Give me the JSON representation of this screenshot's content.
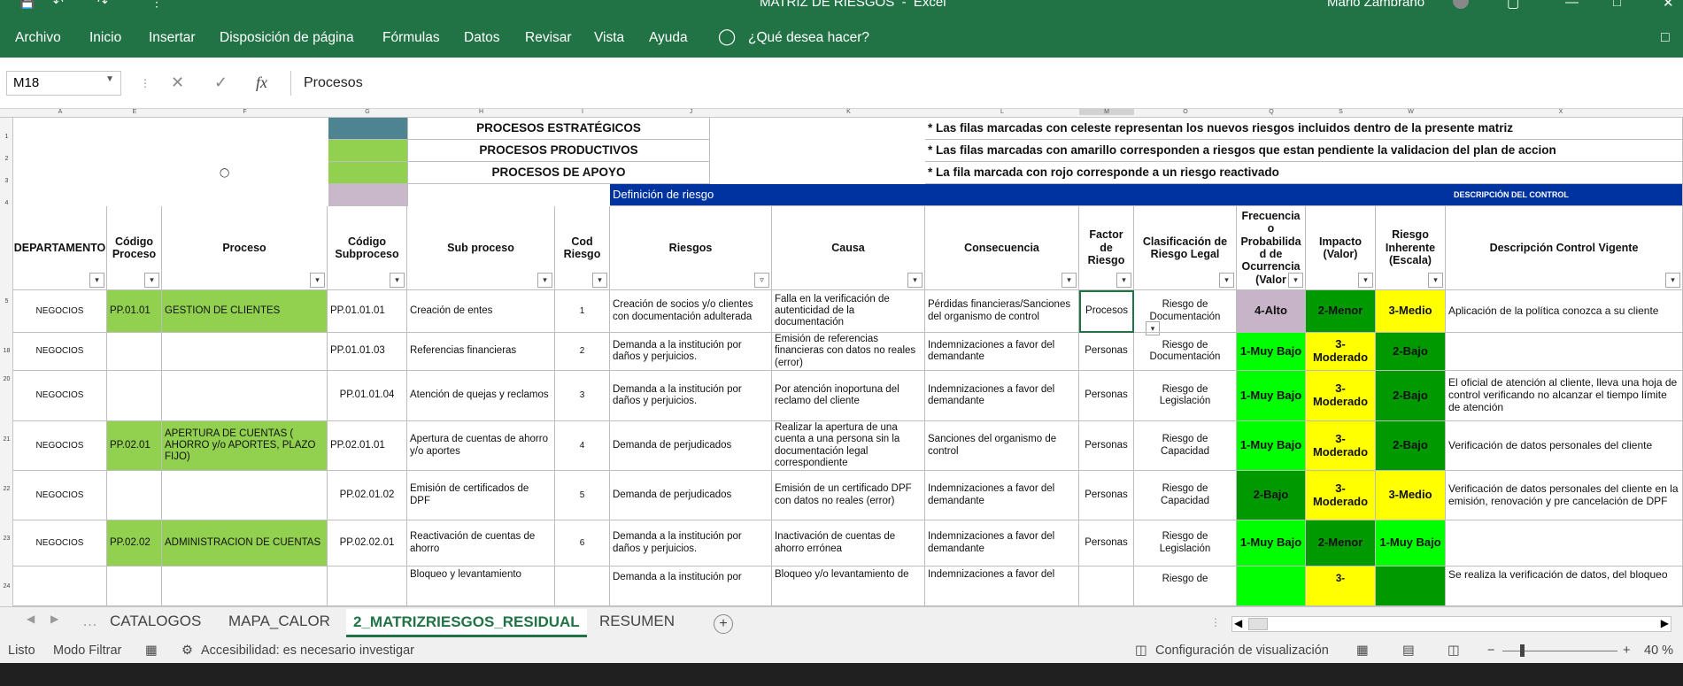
{
  "window": {
    "title": "MATRIZ DE RIESGOS  -  Excel",
    "user": "Mario Zambrano"
  },
  "ribbon": {
    "tabs": [
      "Archivo",
      "Inicio",
      "Insertar",
      "Disposición de página",
      "Fórmulas",
      "Datos",
      "Revisar",
      "Vista",
      "Ayuda",
      "¿Qué desea hacer?"
    ]
  },
  "formula_bar": {
    "name_box": "M18",
    "content": "Procesos"
  },
  "column_headers": [
    "A",
    "E",
    "F",
    "G",
    "H",
    "I",
    "J",
    "K",
    "L",
    "M",
    "O",
    "Q",
    "S",
    "W",
    "X"
  ],
  "row_numbers": [
    "1",
    "2",
    "3",
    "4",
    "5",
    "18",
    "20",
    "21",
    "22",
    "23",
    "24"
  ],
  "legend": {
    "strategic": "PROCESOS ESTRATÉGICOS",
    "productive": "PROCESOS PRODUCTIVOS",
    "support": "PROCESOS DE APOYO",
    "note_1": "* Las filas marcadas con celeste representan los nuevos riesgos incluidos dentro de la presente matriz",
    "note_2": "* Las filas marcadas con amarillo corresponden a riesgos que estan pendiente la validacion del plan de accion",
    "note_3": "* La fila marcada con rojo corresponde a un riesgo reactivado",
    "section_risk": "Definición de riesgo",
    "section_control": "DESCRIPCIÓN DEL CONTROL"
  },
  "table": {
    "headers": [
      "DEPARTAMENTO",
      "Código Proceso",
      "Proceso",
      "Código Subproceso",
      "Sub proceso",
      "Cod Riesgo",
      "Riesgos",
      "Causa",
      "Consecuencia",
      "Factor de Riesgo",
      "Clasificación de Riesgo Legal",
      "Frecuencia o Probabilida d de Ocurrencia (Valor",
      "Impacto (Valor)",
      "Riesgo Inherente (Escala)",
      "Descripción Control Vigente"
    ],
    "rows": [
      [
        "NEGOCIOS",
        "PP.01.01",
        "GESTION DE CLIENTES",
        "PP.01.01.01",
        "Creación de entes",
        "1",
        "Creación de socios y/o clientes con documentación adulterada",
        "Falla en la verificación de autenticidad de la documentación",
        "Pérdidas financieras/Sanciones del organismo de control",
        "Procesos",
        "Riesgo de Documentación",
        "4-Alto",
        "2-Menor",
        "3-Medio",
        "Aplicación de la política conozca a su cliente"
      ],
      [
        "NEGOCIOS",
        "",
        "",
        "PP.01.01.03",
        "Referencias financieras",
        "2",
        "Demanda a la institución por daños y perjuicios.",
        "Emisión de referencias financieras con datos no reales (error)",
        "Indemnizaciones a favor del demandante",
        "Personas",
        "Riesgo de Documentación",
        "1-Muy Bajo",
        "3-Moderado",
        "2-Bajo",
        ""
      ],
      [
        "NEGOCIOS",
        "",
        "",
        "PP.01.01.04",
        "Atención de quejas y reclamos",
        "3",
        "Demanda a la institución por daños y perjuicios.",
        "Por atención inoportuna del reclamo del cliente",
        "Indemnizaciones a favor del demandante",
        "Personas",
        "Riesgo de Legislación",
        "1-Muy Bajo",
        "3-Moderado",
        "2-Bajo",
        "El oficial de atención al cliente, lleva una hoja de control verificando no alcanzar el tiempo límite de atención"
      ],
      [
        "NEGOCIOS",
        "PP.02.01",
        "APERTURA DE CUENTAS ( AHORRO y/o APORTES, PLAZO FIJO)",
        "PP.02.01.01",
        "Apertura  de cuentas de ahorro y/o aportes",
        "4",
        "Demanda de perjudicados",
        "Realizar la apertura de una cuenta a una persona sin la documentación legal correspondiente",
        "Sanciones del organismo de control",
        "Personas",
        "Riesgo de Capacidad",
        "1-Muy Bajo",
        "3-Moderado",
        "2-Bajo",
        "Verificación de datos personales del cliente"
      ],
      [
        "NEGOCIOS",
        "",
        "",
        "PP.02.01.02",
        "Emisión de certificados de DPF",
        "5",
        "Demanda de perjudicados",
        "Emisión de un certificado DPF con datos no reales (error)",
        "Indemnizaciones a favor del demandante",
        "Personas",
        "Riesgo de Capacidad",
        "2-Bajo",
        "3-Moderado",
        "3-Medio",
        "Verificación de datos personales del cliente en la emisión, renovación y pre cancelación de DPF"
      ],
      [
        "NEGOCIOS",
        "PP.02.02",
        "ADMINISTRACION DE CUENTAS",
        "PP.02.02.01",
        "Reactivación de cuentas de ahorro",
        "6",
        "Demanda a la institución por daños y perjuicios.",
        "Inactivación de cuentas de ahorro errónea",
        "Indemnizaciones a favor del demandante",
        "Personas",
        "Riesgo de Legislación",
        "1-Muy Bajo",
        "2-Menor",
        "1-Muy Bajo",
        ""
      ],
      [
        "",
        "",
        "",
        "",
        "Bloqueo y levantamiento",
        "",
        "Demanda a la institución por",
        "Bloqueo y/o levantamiento de",
        "Indemnizaciones a favor del",
        "",
        "Riesgo de",
        "",
        "3-",
        "",
        "Se realiza la verificación de datos, del bloqueo"
      ]
    ]
  },
  "colors": {
    "excel_green": "#217346",
    "legend_strategic": "#4e8391",
    "legend_productive": "#92d050",
    "legend_support": "#c9b8c9",
    "section_blue": "#0033a0",
    "bright_green": "#00ff00",
    "dark_green": "#009900",
    "yellow": "#ffff00",
    "mauve": "#c8b4c8"
  },
  "sheets": {
    "tabs": [
      "CATALOGOS",
      "MAPA_CALOR",
      "2_MATRIZRIESGOS_RESIDUAL",
      "RESUMEN"
    ],
    "active": "2_MATRIZRIESGOS_RESIDUAL"
  },
  "status": {
    "mode": "Listo",
    "filter": "Modo Filtrar",
    "accessibility": "Accesibilidad: es necesario investigar",
    "display_settings": "Configuración de visualización",
    "zoom": "40 %"
  }
}
